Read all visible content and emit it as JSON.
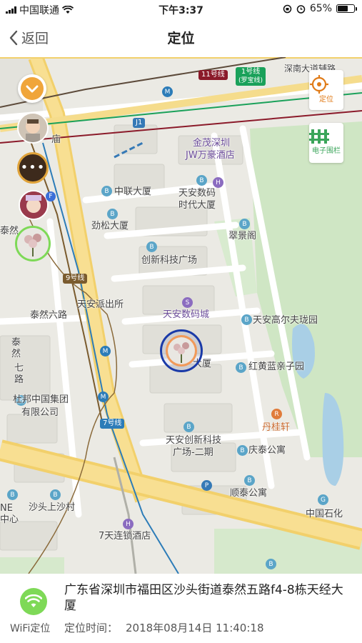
{
  "status_bar": {
    "carrier": "中国联通",
    "time": "下午3:37",
    "battery": "65%",
    "battery_level": 0.65
  },
  "nav": {
    "back_label": "返回",
    "title": "定位"
  },
  "map": {
    "controls": {
      "locate_label": "定位",
      "fence_label": "电子围栏"
    },
    "transit_badges": {
      "line11": "11号线",
      "line1": "1号线",
      "line1_sub": "(罗宝线)",
      "line9": "9号线",
      "line7": "7号线",
      "j1": "J1"
    },
    "labels": {
      "shennan_road": "深南大道辅路",
      "temple": "庙",
      "jinmao": "金茂深圳",
      "jw_hotel": "JW万豪酒店",
      "zhonglian": "中联大厦",
      "tianan_digital_1": "天安数码",
      "tianan_digital_2": "时代大厦",
      "jinsong": "劲松大厦",
      "cuijing": "翠景阁",
      "chuangxin": "创新科技广场",
      "police": "天安派出所",
      "digital_city": "天安数码城",
      "golf": "天安高尔夫珑园",
      "tairan6": "泰然六路",
      "tairan7_a": "泰然",
      "tairan7_b": "七路",
      "tianjing_tail": "大厦",
      "honghuang": "红黄蓝亲子园",
      "dubang_1": "杜邦中国集团",
      "dubang_2": "有限公司",
      "danguixuan": "丹桂轩",
      "innovation_1": "天安创新科技",
      "innovation_2": "广场-二期",
      "qingtai": "庆泰公寓",
      "shuntai": "顺泰公寓",
      "shatou": "沙头上沙村",
      "seven_days": "7天连锁酒店",
      "sinopec": "中国石化",
      "left_edge_1": "泰然",
      "left_edge_2": "NE",
      "left_edge_3": "中心"
    }
  },
  "location": {
    "address": "广东省深圳市福田区沙头街道泰然五路f4-8栋天经大厦",
    "source_label": "WiFi定位",
    "time_label": "定位时间：",
    "time_value": "2018年08月14日 11:40:18"
  },
  "colors": {
    "accent": "#e07b18",
    "wifi_green": "#7ed957",
    "park_green": "#cfe6c4",
    "road_yellow": "#f7d67a"
  }
}
